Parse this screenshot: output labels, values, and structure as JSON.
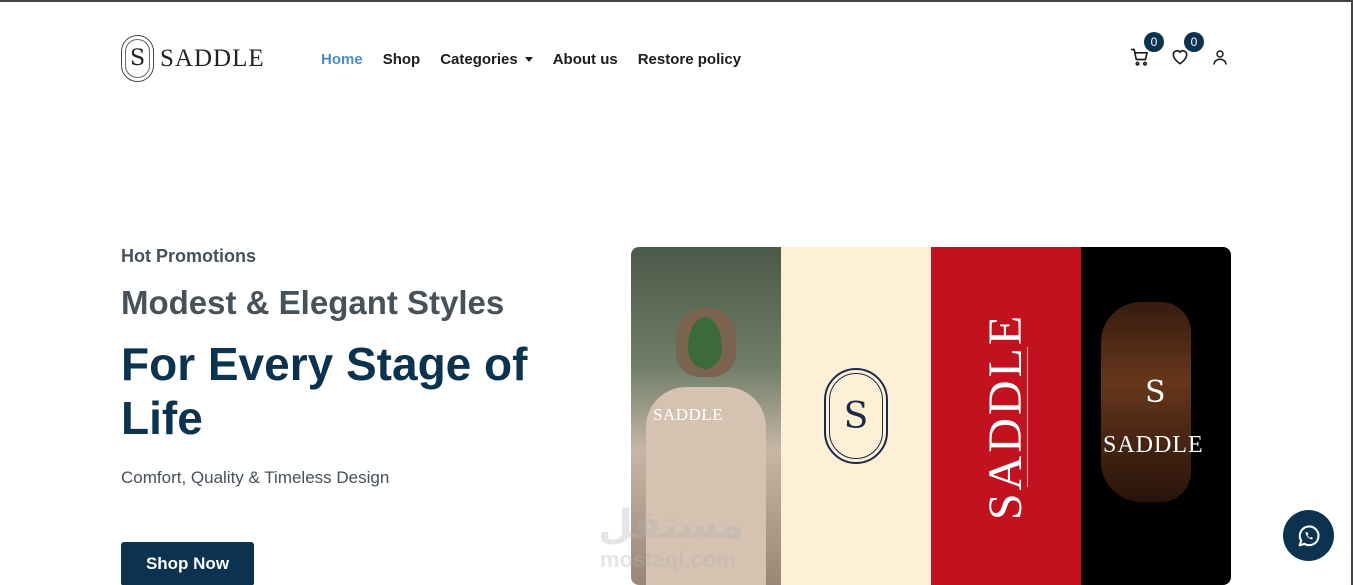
{
  "brand": {
    "name": "SADDLE",
    "mark_letter": "S"
  },
  "nav": {
    "items": [
      {
        "label": "Home",
        "active": true
      },
      {
        "label": "Shop"
      },
      {
        "label": "Categories",
        "has_dropdown": true
      },
      {
        "label": "About us"
      },
      {
        "label": "Restore policy"
      }
    ]
  },
  "header_icons": {
    "cart": {
      "icon": "cart-icon",
      "count": "0"
    },
    "wishlist": {
      "icon": "heart-icon",
      "count": "0"
    },
    "account": {
      "icon": "user-icon"
    }
  },
  "hero": {
    "kicker": "Hot Promotions",
    "headline": "Modest & Elegant Styles",
    "title": "For Every Stage of Life",
    "subtitle": "Comfort, Quality & Timeless Design",
    "cta": "Shop Now"
  },
  "banner": {
    "panel1_mark": "SADDLE",
    "panel2_letter": "S",
    "panel3_text": "SADDLE",
    "panel4_letter": "S",
    "panel4_mark": "SADDLE"
  },
  "watermark": {
    "arabic": "مستقل",
    "latin": "mostaql.com"
  },
  "colors": {
    "primary": "#0b3350",
    "active_link": "#4f8dbf",
    "red": "#c3121f",
    "cream": "#fdf0d6"
  },
  "whatsapp": {
    "icon": "whatsapp-icon"
  }
}
